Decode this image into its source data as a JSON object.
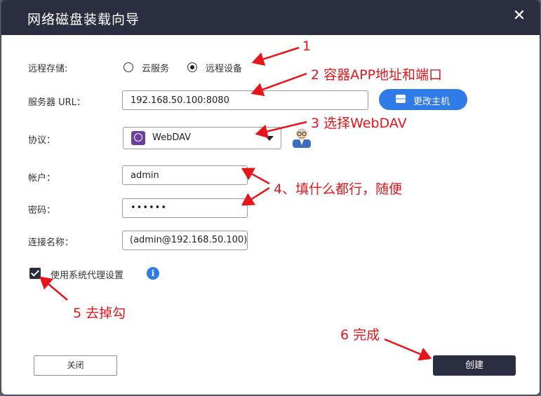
{
  "dialog": {
    "title": "网络磁盘装载向导",
    "close_symbol": "✕"
  },
  "form": {
    "remote_storage_label": "远程存储:",
    "radio_cloud": "云服务",
    "radio_remote_device": "远程设备",
    "selected_radio": "远程设备",
    "server_url_label": "服务器 URL：",
    "server_url_value": "192.168.50.100:8080",
    "change_host_button": "更改主机",
    "protocol_label": "协议：",
    "protocol_value": "WebDAV",
    "account_label": "帐户：",
    "account_value": "admin",
    "password_label": "密码：",
    "password_value": "••••••",
    "connection_name_label": "连接名称：",
    "connection_name_value": "(admin@192.168.50.100)",
    "use_proxy_label": "使用系统代理设置",
    "use_proxy_checked": true,
    "info_symbol": "i"
  },
  "footer": {
    "close_button": "关闭",
    "create_button": "创建"
  },
  "annotations": {
    "a1": "1",
    "a2": "2 容器APP地址和端口",
    "a3": "3 选择WebDAV",
    "a4": "4、填什么都行，随便",
    "a5": "5 去掉勾",
    "a6": "6 完成"
  },
  "colors": {
    "titlebar": "#2b2d41",
    "accent_blue": "#2f7be8",
    "annotation_red": "#e8141a"
  }
}
